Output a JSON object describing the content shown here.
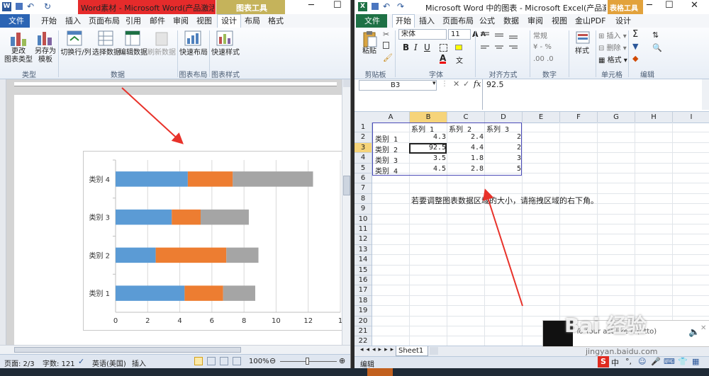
{
  "word": {
    "title": "Word素材 - Microsoft Word(产品激活失...",
    "context_tab_group": "图表工具",
    "tabs": [
      "文件",
      "开始",
      "插入",
      "页面布局",
      "引用",
      "邮件",
      "审阅",
      "视图",
      "设计",
      "布局",
      "格式"
    ],
    "ribbon_buttons": [
      "更改\n图表类型",
      "另存为\n模板",
      "切换行/列",
      "选择数据",
      "编辑数据",
      "刷新数据",
      "快速布局",
      "快速样式"
    ],
    "groups": [
      "类型",
      "数据",
      "图表布局",
      "图表样式"
    ],
    "status": {
      "page": "页面: 2/3",
      "words": "字数: 121",
      "language": "英语(美国)",
      "mode": "插入",
      "zoom": "100%"
    }
  },
  "chart_data": {
    "type": "bar",
    "orientation": "horizontal",
    "stacked": true,
    "categories": [
      "类别 1",
      "类别 2",
      "类别 3",
      "类别 4"
    ],
    "series": [
      {
        "color": "#5b9bd5",
        "values": [
          4.3,
          2.5,
          3.5,
          4.5
        ]
      },
      {
        "color": "#ed7d31",
        "values": [
          2.4,
          4.4,
          1.8,
          2.8
        ]
      },
      {
        "color": "#a5a5a5",
        "values": [
          2,
          2,
          3,
          5
        ]
      }
    ],
    "xlim": [
      0,
      14
    ],
    "xticks": [
      "0",
      "2",
      "4",
      "6",
      "8",
      "10",
      "12",
      "1"
    ],
    "grid": true
  },
  "excel": {
    "title": "Microsoft Word 中的图表 - Microsoft Excel(产品激活失...",
    "context_tab_group": "表格工具",
    "tabs": [
      "文件",
      "开始",
      "插入",
      "页面布局",
      "公式",
      "数据",
      "审阅",
      "视图",
      "金山PDF",
      "设计"
    ],
    "font_name": "宋体",
    "font_size": "11",
    "groups": [
      "剪贴板",
      "字体",
      "对齐方式",
      "数字",
      "样式",
      "单元格",
      "编辑"
    ],
    "number_format": "常规",
    "name_box": "B3",
    "formula_value": "92.5",
    "columns": [
      "A",
      "B",
      "C",
      "D",
      "E",
      "F",
      "G",
      "H",
      "I"
    ],
    "rows": [
      "1",
      "2",
      "3",
      "4",
      "5",
      "6",
      "7",
      "8",
      "9",
      "10",
      "11",
      "12",
      "13",
      "14",
      "15",
      "16",
      "17",
      "18",
      "19",
      "20",
      "21",
      "22"
    ],
    "table": {
      "headers": [
        "系列 1",
        "系列 2",
        "系列 3"
      ],
      "rows": [
        {
          "label": "类别 1",
          "b": "4.3",
          "c": "2.4",
          "d": "2"
        },
        {
          "label": "类别 2",
          "b": "92.5",
          "c": "4.4",
          "d": "2"
        },
        {
          "label": "类别 3",
          "b": "3.5",
          "c": "1.8",
          "d": "3"
        },
        {
          "label": "类别 4",
          "b": "4.5",
          "c": "2.8",
          "d": "5"
        }
      ]
    },
    "note": "若要调整图表数据区域的大小，请拖拽区域的右下角。",
    "sheet_tab": "Sheet1",
    "status": "编辑",
    "popup_text": "To Your ast like a (atto)"
  },
  "watermark": {
    "line1": "Bai 经验",
    "line2": "jingyan.baidu.com"
  }
}
